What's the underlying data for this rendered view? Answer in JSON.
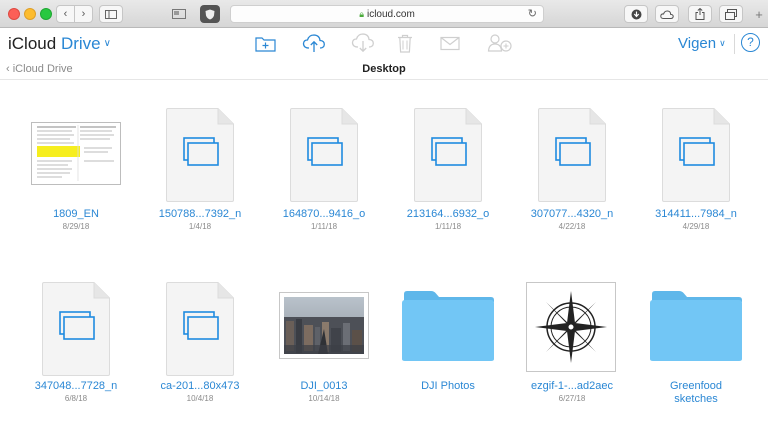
{
  "browser": {
    "url": "icloud.com"
  },
  "app": {
    "brand_first": "iCloud",
    "brand_second": "Drive",
    "user_name": "Vigen",
    "help": "?"
  },
  "breadcrumb": {
    "back_label": "iCloud Drive",
    "current_folder": "Desktop"
  },
  "icons": {
    "toolbar": [
      "new-folder-icon",
      "upload-icon",
      "download-icon",
      "trash-icon",
      "mail-icon",
      "share-icon"
    ]
  },
  "colors": {
    "accent": "#2a87d4",
    "folder": "#72c6f5",
    "doc_icon": "#1f8be0"
  },
  "files": [
    {
      "name": "1809_EN",
      "date": "8/29/18",
      "kind": "spreadsheet"
    },
    {
      "name": "150788...7392_n",
      "date": "1/4/18",
      "kind": "image-doc"
    },
    {
      "name": "164870...9416_o",
      "date": "1/11/18",
      "kind": "image-doc"
    },
    {
      "name": "213164...6932_o",
      "date": "1/11/18",
      "kind": "image-doc"
    },
    {
      "name": "307077...4320_n",
      "date": "4/22/18",
      "kind": "image-doc"
    },
    {
      "name": "314411...7984_n",
      "date": "4/29/18",
      "kind": "image-doc"
    },
    {
      "name": "347048...7728_n",
      "date": "6/8/18",
      "kind": "image-doc"
    },
    {
      "name": "ca-201...80x473",
      "date": "10/4/18",
      "kind": "image-doc"
    },
    {
      "name": "DJI_0013",
      "date": "10/14/18",
      "kind": "photo"
    },
    {
      "name": "DJI Photos",
      "date": "",
      "kind": "folder"
    },
    {
      "name": "ezgif-1-...ad2aec",
      "date": "6/27/18",
      "kind": "compass"
    },
    {
      "name": "Greenfood sketches",
      "date": "",
      "kind": "folder"
    }
  ]
}
